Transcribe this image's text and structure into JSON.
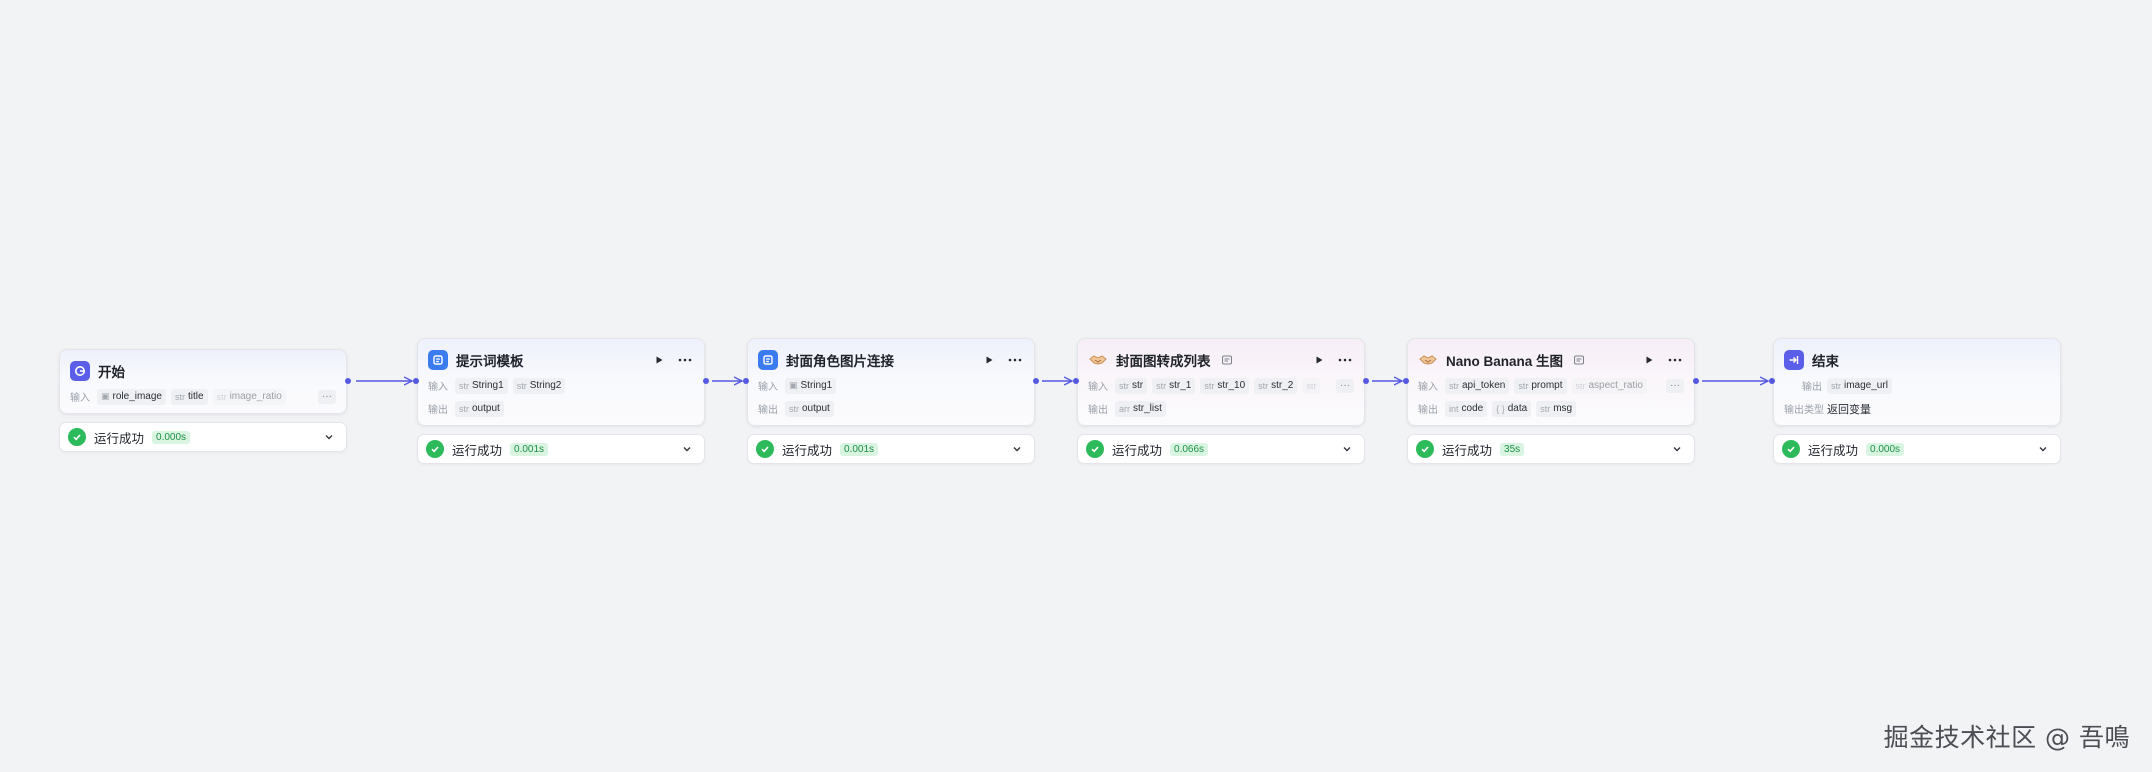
{
  "nodes": {
    "start": {
      "title": "开始",
      "input_label": "输入",
      "inputs": [
        {
          "type": "img",
          "name": "role_image"
        },
        {
          "type": "str",
          "name": "title"
        },
        {
          "type": "str",
          "name": "image_ratio"
        }
      ],
      "more": "···",
      "status": "运行成功",
      "time": "0.000s"
    },
    "prompt": {
      "title": "提示词模板",
      "input_label": "输入",
      "output_label": "输出",
      "inputs": [
        {
          "type": "str",
          "name": "String1"
        },
        {
          "type": "str",
          "name": "String2"
        }
      ],
      "outputs": [
        {
          "type": "str",
          "name": "output"
        }
      ],
      "status": "运行成功",
      "time": "0.001s"
    },
    "cover_link": {
      "title": "封面角色图片连接",
      "input_label": "输入",
      "output_label": "输出",
      "inputs": [
        {
          "type": "img",
          "name": "String1"
        }
      ],
      "outputs": [
        {
          "type": "str",
          "name": "output"
        }
      ],
      "status": "运行成功",
      "time": "0.001s"
    },
    "to_list": {
      "title": "封面图转成列表",
      "input_label": "输入",
      "output_label": "输出",
      "inputs": [
        {
          "type": "str",
          "name": "str"
        },
        {
          "type": "str",
          "name": "str_1"
        },
        {
          "type": "str",
          "name": "str_10"
        },
        {
          "type": "str",
          "name": "str_2"
        },
        {
          "type": "str",
          "name": ""
        }
      ],
      "more": "···",
      "outputs": [
        {
          "type": "arr",
          "name": "str_list"
        }
      ],
      "status": "运行成功",
      "time": "0.066s"
    },
    "nano": {
      "title": "Nano Banana 生图",
      "input_label": "输入",
      "output_label": "输出",
      "inputs": [
        {
          "type": "str",
          "name": "api_token"
        },
        {
          "type": "str",
          "name": "prompt"
        },
        {
          "type": "str",
          "name": "aspect_ratio"
        }
      ],
      "more": "···",
      "outputs": [
        {
          "type": "int",
          "name": "code"
        },
        {
          "type": "{ }",
          "name": "data"
        },
        {
          "type": "str",
          "name": "msg"
        }
      ],
      "status": "运行成功",
      "time": "35s"
    },
    "end": {
      "title": "结束",
      "output_label": "输出",
      "outputs": [
        {
          "type": "str",
          "name": "image_url"
        }
      ],
      "type_label": "输出类型",
      "type_value": "返回变量",
      "status": "运行成功",
      "time": "0.000s"
    }
  },
  "watermark": "掘金技术社区 @ 吾鳴",
  "colors": {
    "background": "#f2f3f5",
    "edge": "#5559e0",
    "success": "#2dba5a",
    "badge_bg": "#d9f5e2",
    "badge_text": "#1d8f43"
  },
  "icons": {
    "start": "start-icon",
    "prompt": "template-icon",
    "cover_link": "code-icon",
    "to_list": "plugin-handshake-icon",
    "nano": "plugin-handshake-icon",
    "end": "end-icon",
    "run": "play-icon",
    "menu": "more-icon",
    "status": "check-circle-icon",
    "expand": "chevron-down-icon"
  }
}
